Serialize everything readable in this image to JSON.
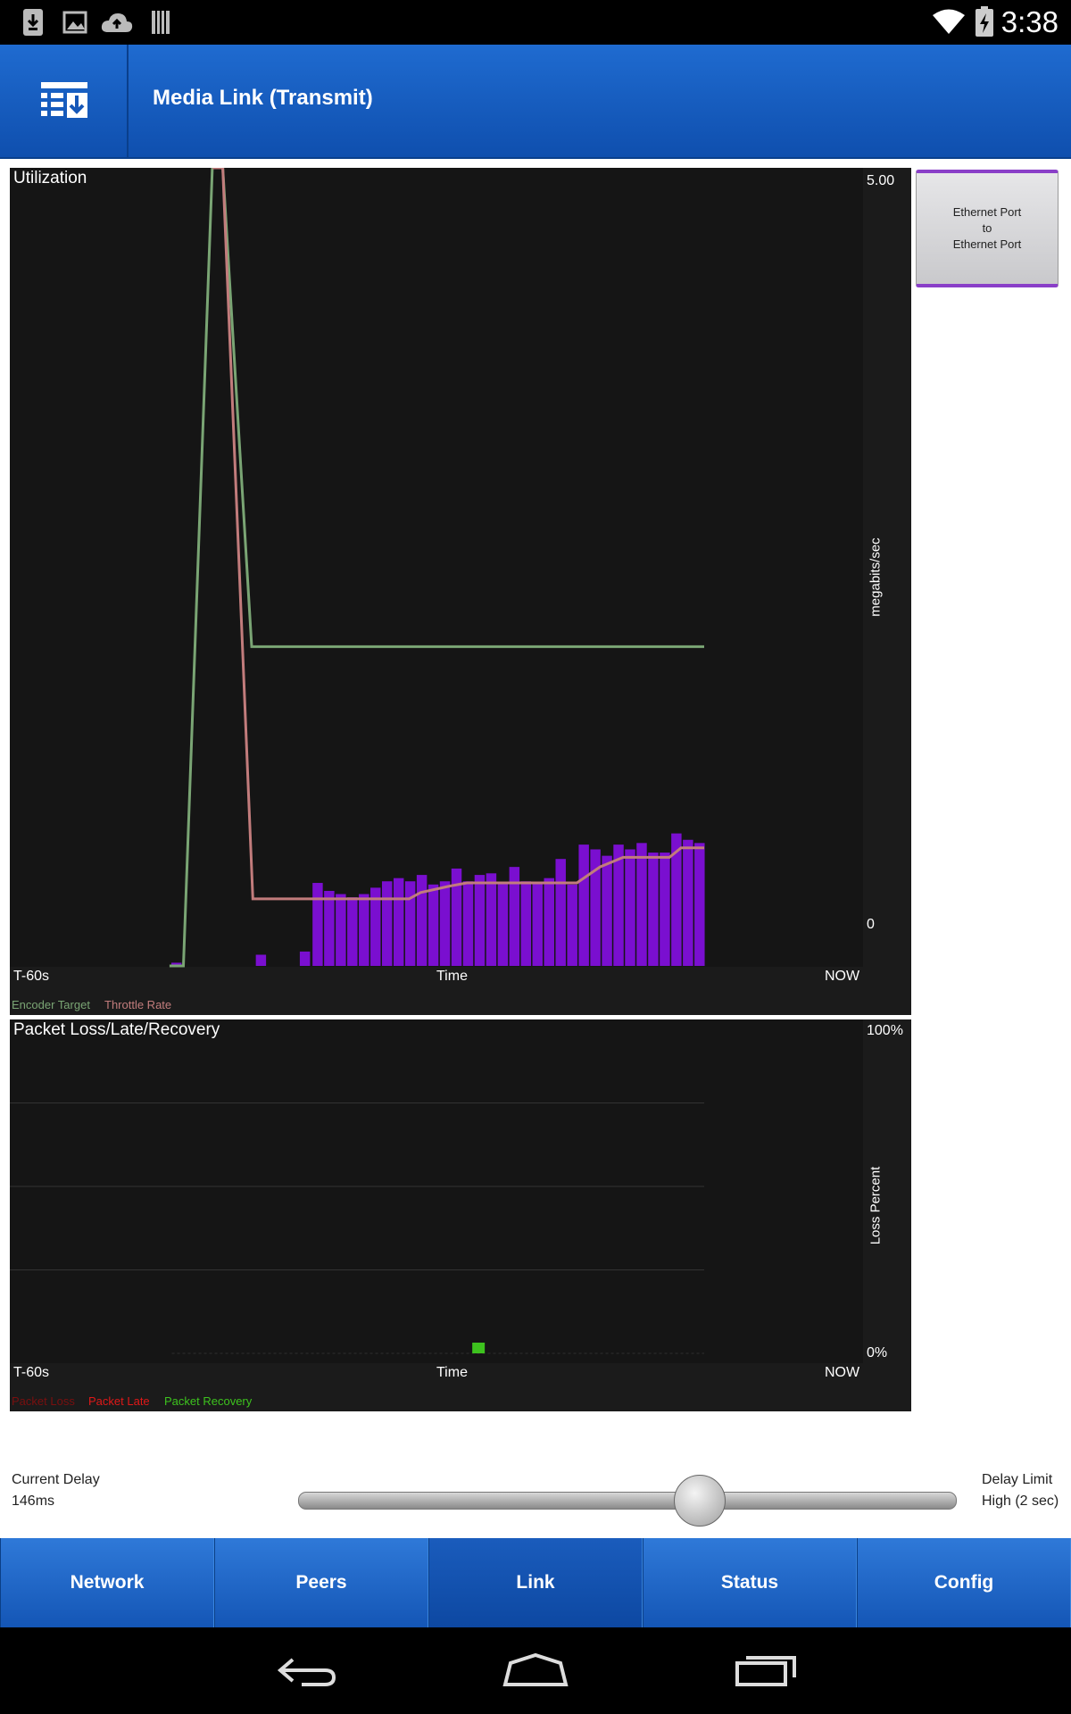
{
  "status_bar": {
    "time": "3:38",
    "icons": [
      "download-icon",
      "image-icon",
      "cloud-upload-icon",
      "sd-card-icon",
      "wifi-icon",
      "battery-charging-icon"
    ]
  },
  "header": {
    "title": "Media Link (Transmit)",
    "logo_icon": "menu-download-icon"
  },
  "utilization": {
    "title": "Utilization",
    "y_max_label": "5.00",
    "y_min_label": "0",
    "y_axis_label": "megabits/sec",
    "x_start": "T-60s",
    "x_mid": "Time",
    "x_end": "NOW",
    "legend": [
      {
        "label": "Encoder Target",
        "color": "#7aa574"
      },
      {
        "label": "Throttle Rate",
        "color": "#c27c7c"
      }
    ]
  },
  "packet_loss": {
    "title": "Packet Loss/Late/Recovery",
    "y_max_label": "100%",
    "y_min_label": "0%",
    "y_axis_label": "Loss Percent",
    "x_start": "T-60s",
    "x_mid": "Time",
    "x_end": "NOW",
    "legend": [
      {
        "label": "Packet Loss",
        "color": "#7a0f0f"
      },
      {
        "label": "Packet Late",
        "color": "#e01818"
      },
      {
        "label": "Packet Recovery",
        "color": "#3dc21e"
      }
    ]
  },
  "chart_data": [
    {
      "type": "bar",
      "title": "Utilization",
      "xlabel": "Time",
      "ylabel": "megabits/sec",
      "ylim": [
        0,
        5
      ],
      "x_range": [
        -60,
        0
      ],
      "bar_color": "#7a0fd0",
      "bars": [
        {
          "t": -45.6,
          "v": 0.02
        },
        {
          "t": -38.3,
          "v": 0.07
        },
        {
          "t": -34.5,
          "v": 0.09
        },
        {
          "t": -33.4,
          "v": 0.52
        },
        {
          "t": -32.4,
          "v": 0.47
        },
        {
          "t": -31.4,
          "v": 0.45
        },
        {
          "t": -30.4,
          "v": 0.43
        },
        {
          "t": -29.4,
          "v": 0.45
        },
        {
          "t": -28.4,
          "v": 0.49
        },
        {
          "t": -27.4,
          "v": 0.53
        },
        {
          "t": -26.4,
          "v": 0.55
        },
        {
          "t": -25.4,
          "v": 0.53
        },
        {
          "t": -24.4,
          "v": 0.57
        },
        {
          "t": -23.4,
          "v": 0.51
        },
        {
          "t": -22.4,
          "v": 0.53
        },
        {
          "t": -21.4,
          "v": 0.61
        },
        {
          "t": -20.4,
          "v": 0.53
        },
        {
          "t": -19.4,
          "v": 0.57
        },
        {
          "t": -18.4,
          "v": 0.58
        },
        {
          "t": -17.4,
          "v": 0.52
        },
        {
          "t": -16.4,
          "v": 0.62
        },
        {
          "t": -15.4,
          "v": 0.53
        },
        {
          "t": -14.4,
          "v": 0.52
        },
        {
          "t": -13.4,
          "v": 0.55
        },
        {
          "t": -12.4,
          "v": 0.67
        },
        {
          "t": -11.4,
          "v": 0.51
        },
        {
          "t": -10.4,
          "v": 0.76
        },
        {
          "t": -9.4,
          "v": 0.73
        },
        {
          "t": -8.4,
          "v": 0.69
        },
        {
          "t": -7.4,
          "v": 0.76
        },
        {
          "t": -6.4,
          "v": 0.73
        },
        {
          "t": -5.4,
          "v": 0.77
        },
        {
          "t": -4.4,
          "v": 0.71
        },
        {
          "t": -3.4,
          "v": 0.71
        },
        {
          "t": -2.4,
          "v": 0.83
        },
        {
          "t": -1.4,
          "v": 0.79
        },
        {
          "t": -0.4,
          "v": 0.77
        }
      ],
      "series": [
        {
          "name": "Encoder Target",
          "color": "#7aa574",
          "points": [
            [
              -46.2,
              0
            ],
            [
              -45.0,
              0
            ],
            [
              -42.5,
              5.0
            ],
            [
              -41.6,
              5.0
            ],
            [
              -39.1,
              2.0
            ],
            [
              0,
              2.0
            ]
          ]
        },
        {
          "name": "Throttle Rate",
          "color": "#c27c7c",
          "points": [
            [
              -42.5,
              5.0
            ],
            [
              -41.6,
              5.0
            ],
            [
              -39.0,
              0.42
            ],
            [
              -29.0,
              0.42
            ],
            [
              -25.5,
              0.42
            ],
            [
              -24.5,
              0.46
            ],
            [
              -22.0,
              0.5
            ],
            [
              -20.5,
              0.52
            ],
            [
              -11.0,
              0.52
            ],
            [
              -9.0,
              0.62
            ],
            [
              -7.0,
              0.68
            ],
            [
              -3.0,
              0.68
            ],
            [
              -2.0,
              0.74
            ],
            [
              0,
              0.74
            ]
          ]
        }
      ]
    },
    {
      "type": "bar",
      "title": "Packet Loss/Late/Recovery",
      "xlabel": "Time",
      "ylabel": "Loss Percent",
      "ylim": [
        0,
        100
      ],
      "x_range": [
        -60,
        0
      ],
      "baseline_start": -46.0,
      "grid_y": [
        25,
        50,
        75
      ],
      "series": [
        {
          "name": "Packet Recovery",
          "color": "#3dc21e",
          "points": [
            [
              -19.5,
              3
            ]
          ]
        }
      ]
    }
  ],
  "side_button": {
    "line1": "Ethernet Port",
    "line2": "to",
    "line3": "Ethernet Port"
  },
  "delay": {
    "current_label": "Current Delay",
    "current_value": "146ms",
    "limit_label": "Delay Limit",
    "limit_value": "High (2 sec)",
    "slider_fraction": 0.61
  },
  "nav": {
    "tabs": [
      "Network",
      "Peers",
      "Link",
      "Status",
      "Config"
    ],
    "active": "Link"
  },
  "system_nav": [
    "back-icon",
    "home-icon",
    "recent-apps-icon"
  ]
}
